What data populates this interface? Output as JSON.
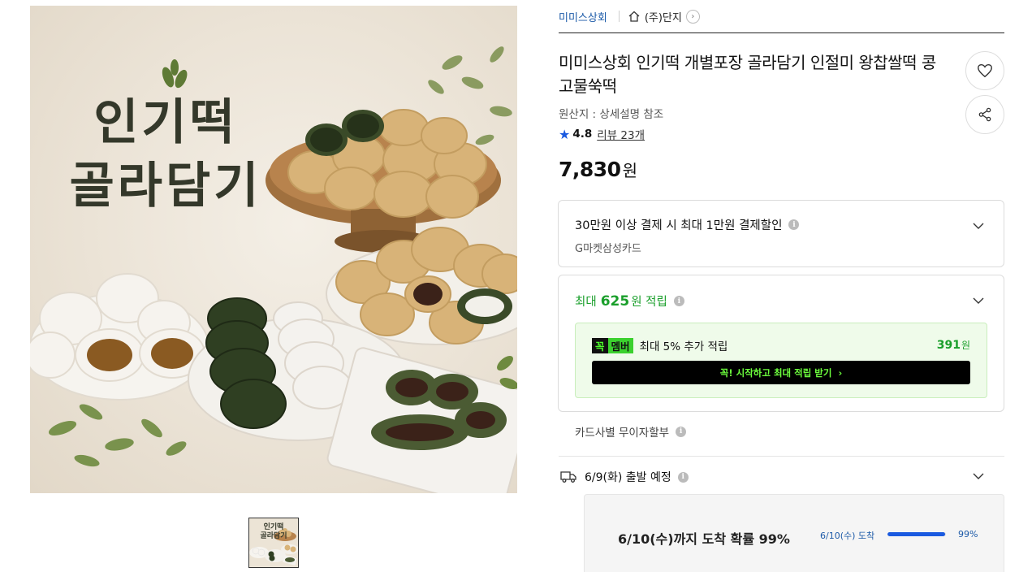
{
  "product_image": {
    "title_line1": "인기떡",
    "title_line2": "골라담기"
  },
  "thumbnail": {
    "line1": "인기떡",
    "line2": "골라담기"
  },
  "breadcrumb": {
    "seller": "미미스상회",
    "store": "(주)단지"
  },
  "product": {
    "title": "미미스상회 인기떡 개별포장 골라담기 인절미 왕찹쌀떡 콩고물쑥떡",
    "origin": "원산지 : 상세설명 참조",
    "rating": "4.8",
    "review_link": "리뷰 23개",
    "price": "7,830",
    "price_unit": "원"
  },
  "discount": {
    "title": "30만원 이상 결제 시 최대 1만원 결제할인",
    "subtitle": "G마켓삼성카드"
  },
  "points": {
    "prefix": "최대",
    "amount": "625",
    "suffix": "원 적립",
    "member_badge_a": "꼭",
    "member_badge_b": "멤버",
    "member_text": "최대 5% 추가 적립",
    "member_points": "391",
    "member_points_unit": "원",
    "cta": "꼭! 시작하고 최대 적립 받기",
    "cta_arrow": "›"
  },
  "installment": {
    "label": "카드사별 무이자할부"
  },
  "shipping": {
    "label": "6/9(화) 출발 예정"
  },
  "delivery": {
    "main": "6/10(수)까지 도착 확률 99%",
    "date_label": "6/10(수) 도착",
    "probability_percent": 99,
    "probability_label": "99%"
  },
  "colors": {
    "link_blue": "#1c5aa8",
    "accent_blue": "#1a5ae0",
    "points_green": "#1a9f2b",
    "member_bg": "#effbea",
    "cta_text_green": "#6dff3d"
  },
  "icons": {
    "home": "home-icon",
    "chevron_right_circle": "chevron-right-circle-icon",
    "heart": "heart-icon",
    "share": "share-icon",
    "star": "star-icon",
    "info": "info-icon",
    "chevron_down": "chevron-down-icon",
    "truck": "truck-icon"
  }
}
